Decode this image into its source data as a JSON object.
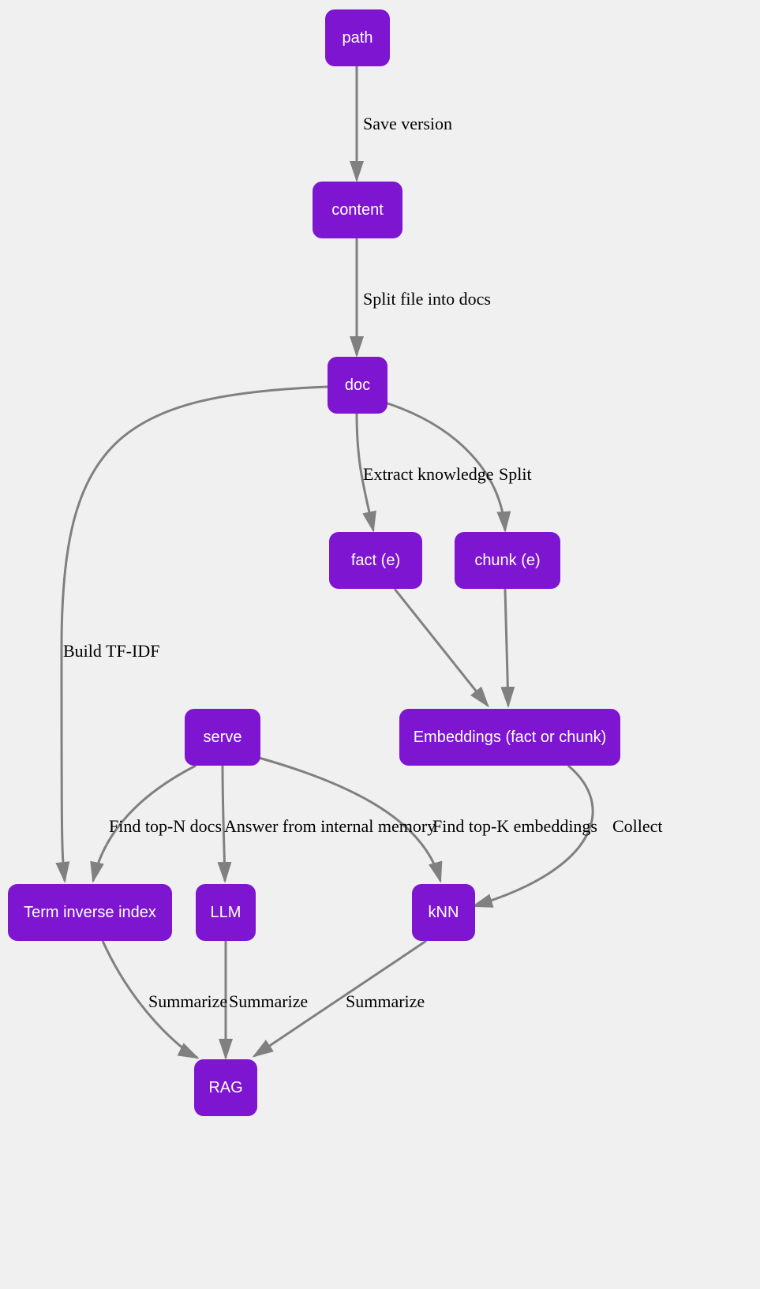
{
  "nodes": {
    "path": {
      "label": "path"
    },
    "content": {
      "label": "content"
    },
    "doc": {
      "label": "doc"
    },
    "fact": {
      "label": "fact (e)"
    },
    "chunk": {
      "label": "chunk (e)"
    },
    "serve": {
      "label": "serve"
    },
    "embeddings": {
      "label": "Embeddings (fact or chunk)"
    },
    "tii": {
      "label": "Term inverse index"
    },
    "llm": {
      "label": "LLM"
    },
    "knn": {
      "label": "kNN"
    },
    "rag": {
      "label": "RAG"
    }
  },
  "edges": {
    "path_content": {
      "label": "Save version"
    },
    "content_doc": {
      "label": "Split file into docs"
    },
    "doc_fact": {
      "label": "Extract knowledge"
    },
    "doc_chunk": {
      "label": "Split"
    },
    "doc_tii": {
      "label": "Build TF-IDF"
    },
    "serve_tii": {
      "label": "Find top-N docs"
    },
    "serve_llm": {
      "label": "Answer from internal memory"
    },
    "serve_knn": {
      "label": "Find top-K embeddings"
    },
    "emb_knn": {
      "label": "Collect"
    },
    "tii_rag": {
      "label": "Summarize"
    },
    "llm_rag": {
      "label": "Summarize"
    },
    "knn_rag": {
      "label": "Summarize"
    }
  }
}
